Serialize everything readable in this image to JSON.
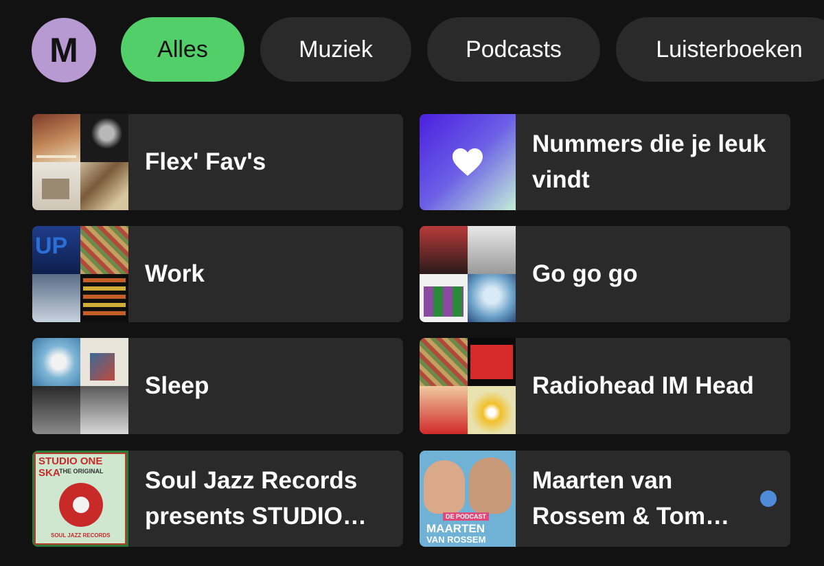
{
  "profile": {
    "initial": "M"
  },
  "filters": [
    {
      "label": "Alles",
      "active": true
    },
    {
      "label": "Muziek",
      "active": false
    },
    {
      "label": "Podcasts",
      "active": false
    },
    {
      "label": "Luisterboeken",
      "active": false
    }
  ],
  "items": [
    {
      "title": "Flex'  Fav's",
      "art": "collage"
    },
    {
      "title": "Nummers die je leuk vindt",
      "art": "liked-songs"
    },
    {
      "title": "Work",
      "art": "collage"
    },
    {
      "title": "Go go go",
      "art": "collage"
    },
    {
      "title": "Sleep",
      "art": "collage"
    },
    {
      "title": "Radiohead IM Head",
      "art": "collage"
    },
    {
      "title": "Soul Jazz Records presents STUDIO ONE SKA",
      "art": "album-cover",
      "cover_text": [
        "STUDIO ONE SKA",
        "THE ORIGINAL",
        "SOUL JAZZ RECORDS"
      ]
    },
    {
      "title": "Maarten van Rossem & Tom Jessen",
      "art": "podcast-cover",
      "cover_text": [
        "DE PODCAST",
        "MAARTEN",
        "VAN ROSSEM"
      ],
      "has_new": true
    }
  ],
  "colors": {
    "accent": "#53cf6a",
    "background": "#121212",
    "card": "#2a2a2a",
    "new_dot": "#4f8bd9"
  }
}
